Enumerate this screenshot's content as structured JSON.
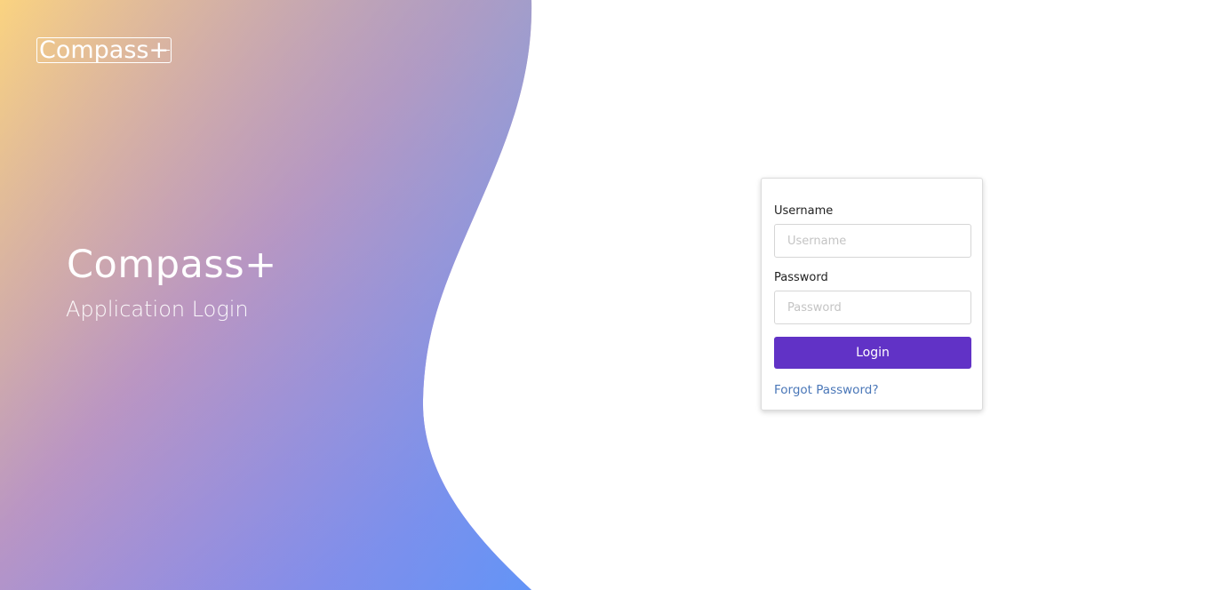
{
  "logo": {
    "text": "Compass+"
  },
  "hero": {
    "title": "Compass+",
    "subtitle": "Application Login"
  },
  "form": {
    "username_label": "Username",
    "username_placeholder": "Username",
    "username_value": "",
    "password_label": "Password",
    "password_placeholder": "Password",
    "password_value": "",
    "login_label": "Login",
    "forgot_label": "Forgot Password?"
  },
  "colors": {
    "accent": "#6132c6",
    "link": "#4a77b8",
    "gradient_top_left": "#ff9a7f",
    "gradient_top_right": "#f9e181",
    "gradient_bottom_left": "#9a63f3",
    "gradient_bottom_right": "#5a9cf7"
  }
}
